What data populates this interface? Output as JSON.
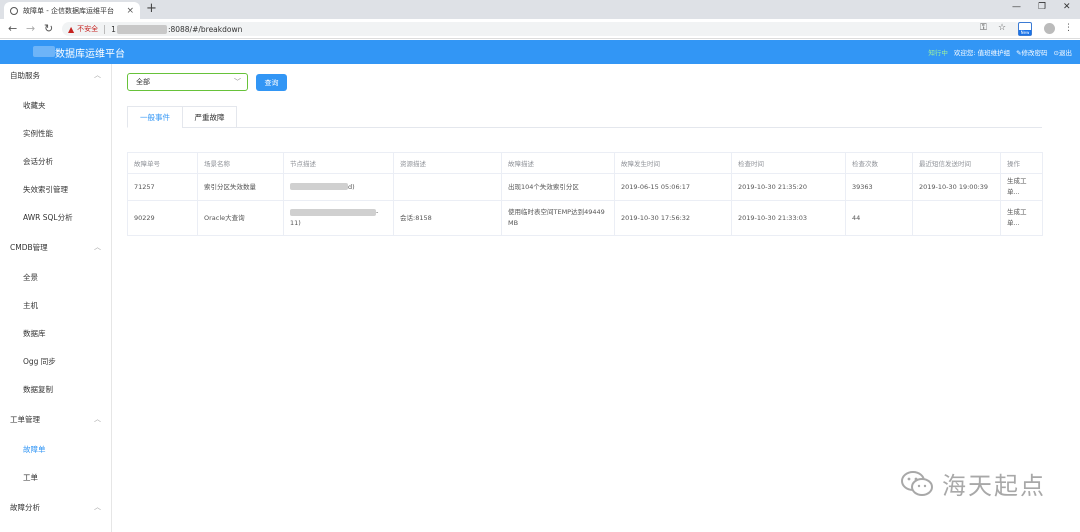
{
  "browser": {
    "tab_title": "故障单 - 企信数据库运维平台",
    "tab_close": "×",
    "new_tab": "+",
    "insecure_label": "不安全",
    "url_visible": ":8088/#/breakdown",
    "url_prefix": "1",
    "new_badge": "New"
  },
  "header": {
    "brand": "数据库运维平台",
    "online_status": "知行中",
    "welcome": "欢迎您: 值班维护组",
    "change_password": "✎修改密码",
    "logout": "⊙退出"
  },
  "sidebar": {
    "groups": [
      {
        "label": "自助服务",
        "items": [
          "收藏夹",
          "实例性能",
          "会话分析",
          "失效索引管理",
          "AWR SQL分析"
        ]
      },
      {
        "label": "CMDB管理",
        "items": [
          "全景",
          "主机",
          "数据库",
          "Ogg 同步",
          "数据复制"
        ]
      },
      {
        "label": "工单管理",
        "items": [
          "故障单",
          "工单"
        ]
      },
      {
        "label": "故障分析",
        "items": []
      }
    ],
    "active_item": "故障单"
  },
  "filter": {
    "select_value": "全部",
    "query_button": "查询"
  },
  "tabs": [
    "一般事件",
    "严重故障"
  ],
  "table": {
    "columns": [
      "故障单号",
      "场景名称",
      "节点描述",
      "资源描述",
      "故障描述",
      "故障发生时间",
      "检查时间",
      "检查次数",
      "最近短信发送时间",
      "操作"
    ],
    "rows": [
      {
        "id": "71257",
        "scene": "索引分区失效数量",
        "node": "d)",
        "resource": "",
        "desc": "出现104个失效索引分区",
        "occurred": "2019-06-15 05:06:17",
        "checked": "2019-10-30 21:35:20",
        "count": "39363",
        "sms": "2019-10-30 19:00:39",
        "action": "生成工单..."
      },
      {
        "id": "90229",
        "scene": "Oracle大查询",
        "node": "11)",
        "node_suffix": "-",
        "resource": "会话:8158",
        "desc": "使用临时表空间TEMP达到49449 MB",
        "occurred": "2019-10-30 17:56:32",
        "checked": "2019-10-30 21:33:03",
        "count": "44",
        "sms": "",
        "action": "生成工单..."
      }
    ]
  },
  "watermark": "海天起点",
  "colors": {
    "primary": "#3296f5",
    "select_border": "#67c23a"
  }
}
